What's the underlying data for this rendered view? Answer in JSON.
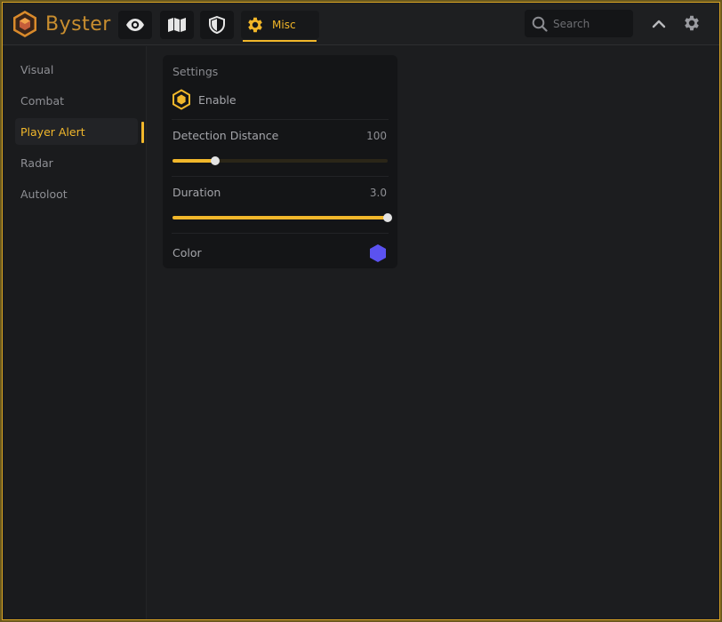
{
  "app": {
    "name": "Byster"
  },
  "tabs": [
    {
      "icon": "eye-icon",
      "label": ""
    },
    {
      "icon": "map-icon",
      "label": ""
    },
    {
      "icon": "shield-icon",
      "label": ""
    },
    {
      "icon": "gear-icon",
      "label": "Misc",
      "active": true
    }
  ],
  "search": {
    "placeholder": "Search",
    "value": ""
  },
  "header_actions": [
    "chevron-up-icon",
    "settings-gear-icon"
  ],
  "sidebar": {
    "items": [
      {
        "label": "Visual"
      },
      {
        "label": "Combat"
      },
      {
        "label": "Player Alert",
        "active": true
      },
      {
        "label": "Radar"
      },
      {
        "label": "Autoloot"
      }
    ]
  },
  "settings": {
    "title": "Settings",
    "enable": {
      "label": "Enable",
      "checked": true
    },
    "detection_distance": {
      "label": "Detection Distance",
      "value": "100",
      "fraction": 0.2
    },
    "duration": {
      "label": "Duration",
      "value": "3.0",
      "fraction": 1.0
    },
    "color": {
      "label": "Color",
      "value": "#5b52f0"
    }
  },
  "colors": {
    "accent": "#f1b72b",
    "background": "#1c1d1f",
    "panel": "#141517",
    "border": "#d8a324"
  }
}
